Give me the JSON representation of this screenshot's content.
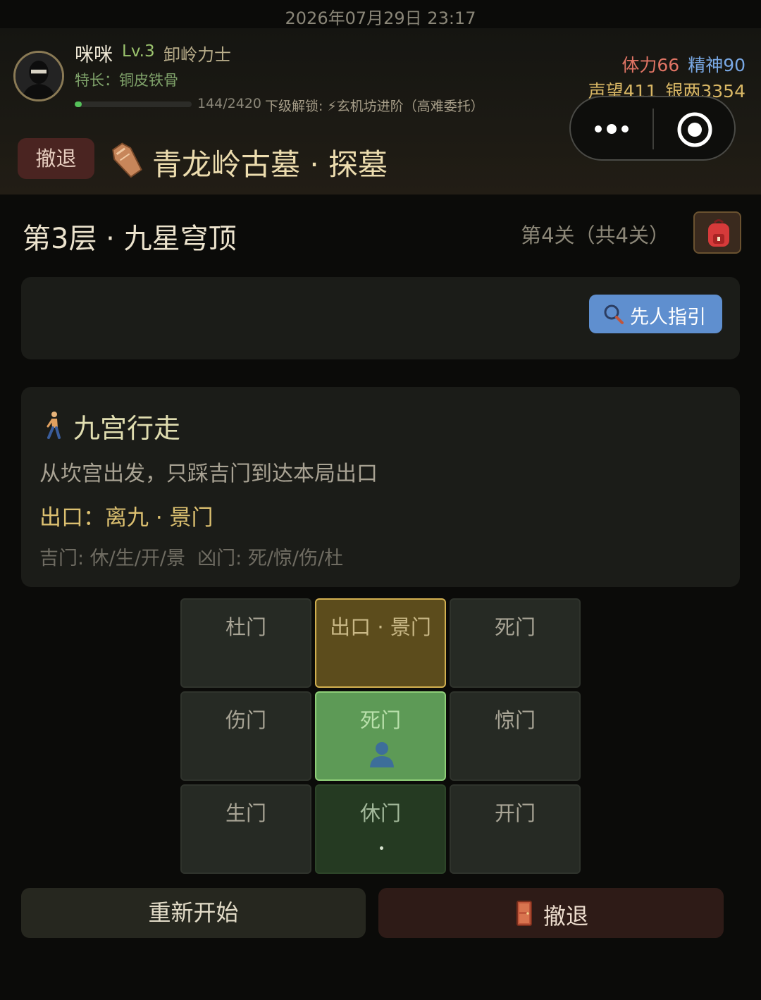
{
  "status_bar": {
    "datetime": "2026年07月29日 23:17"
  },
  "player": {
    "name": "咪咪",
    "level": "Lv.3",
    "title": "卸岭力士",
    "specialty": "特长：铜皮铁骨",
    "xp_text": "144/2420",
    "xp_progress": 0.06,
    "unlock_text": "下级解锁: ⚡玄机坊进阶（高难委托）"
  },
  "stats": {
    "hp": "体力66",
    "spirit": "精神90",
    "reputation": "声望411",
    "silver": "银两3354"
  },
  "header": {
    "retreat_label": "撤退",
    "dungeon_title": "青龙岭古墓 · 探墓"
  },
  "floor": {
    "title": "第3层 · 九星穹顶",
    "stage": "第4关（共4关）"
  },
  "hint": {
    "button_label": "先人指引"
  },
  "puzzle": {
    "title": "九宫行走",
    "description": "从坎宫出发，只踩吉门到达本局出口",
    "exit": "出口：离九 · 景门",
    "gates": "吉门: 休/生/开/景  凶门: 死/惊/伤/杜"
  },
  "grid": {
    "cells": [
      {
        "label": "杜门",
        "state": "normal"
      },
      {
        "label": "出口 · 景门",
        "state": "exit"
      },
      {
        "label": "死门",
        "state": "normal"
      },
      {
        "label": "伤门",
        "state": "normal"
      },
      {
        "label": "死门",
        "state": "current"
      },
      {
        "label": "惊门",
        "state": "normal"
      },
      {
        "label": "生门",
        "state": "normal"
      },
      {
        "label": "休门",
        "state": "path"
      },
      {
        "label": "开门",
        "state": "normal"
      }
    ]
  },
  "actions": {
    "restart_label": "重新开始",
    "retreat_label": "撤退"
  },
  "colors": {
    "background": "#0b0b09",
    "panel": "#1b1c18",
    "exit_cell": "#5c4c1c",
    "current_cell": "#5d9a56",
    "hint_button": "#5f8fcf",
    "hp": "#e07464",
    "spirit": "#79a8e4",
    "gold": "#d9b765"
  }
}
